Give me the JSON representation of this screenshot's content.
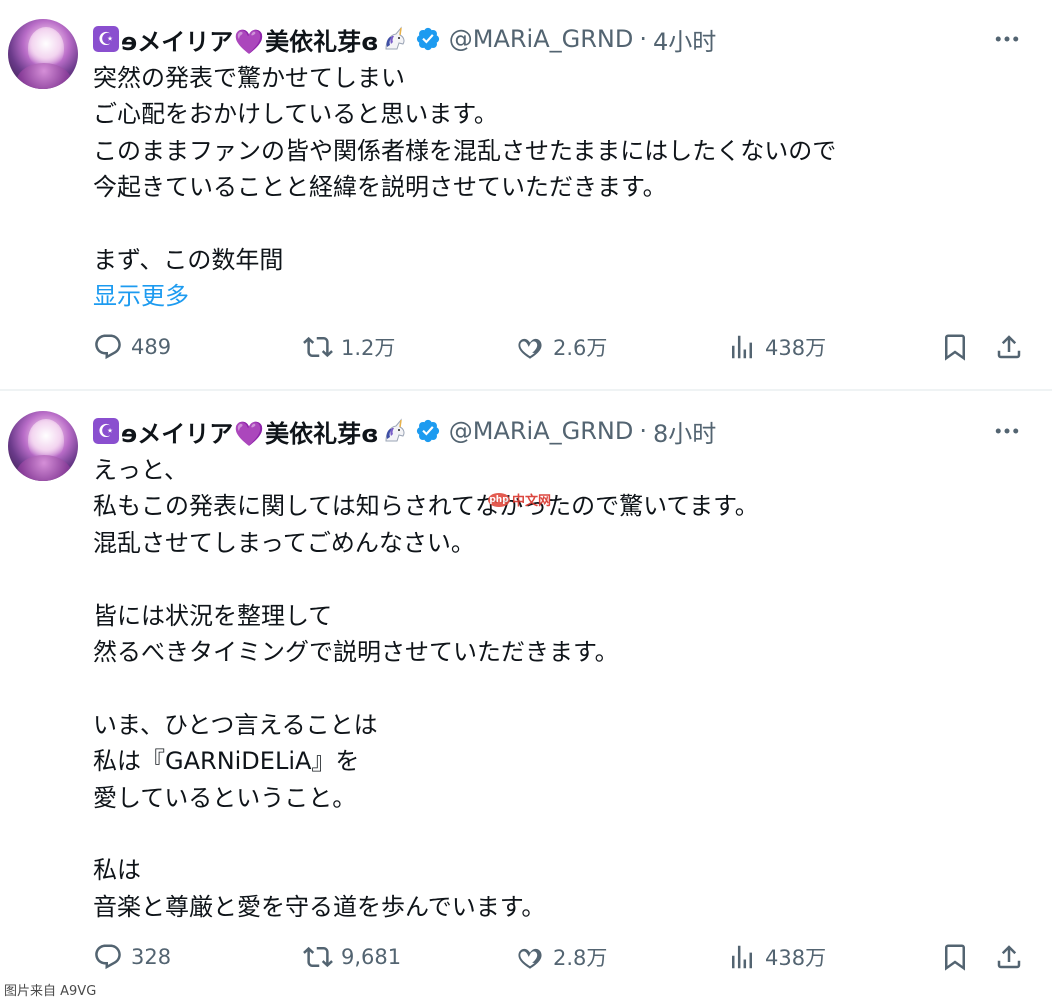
{
  "tweets": [
    {
      "author": {
        "moon_badge": "☪",
        "name_prefix": "ɘメイリア",
        "heart": "💜",
        "name_suffix": "美依礼芽ɞ",
        "handle": "@MARiA_GRND",
        "separator": "·",
        "time": "4小时"
      },
      "lines": [
        "突然の発表で驚かせてしまい",
        "ご心配をおかけしていると思います。",
        "このままファンの皆や関係者様を混乱させたままにはしたくないので",
        "今起きていることと経緯を説明させていただきます。",
        "",
        "まず、この数年間"
      ],
      "show_more": "显示更多",
      "stats": {
        "replies": "489",
        "reposts": "1.2万",
        "likes": "2.6万",
        "views": "438万"
      }
    },
    {
      "author": {
        "moon_badge": "☪",
        "name_prefix": "ɘメイリア",
        "heart": "💜",
        "name_suffix": "美依礼芽ɞ",
        "handle": "@MARiA_GRND",
        "separator": "·",
        "time": "8小时"
      },
      "lines": [
        "えっと、",
        "私もこの発表に関しては知らされてなかったので驚いてます。",
        "混乱させてしまってごめんなさい。",
        "",
        "皆には状況を整理して",
        "然るべきタイミングで説明させていただきます。",
        "",
        "いま、ひとつ言えることは",
        "私は『GARNiDELiA』を",
        "愛しているということ。",
        "",
        "私は",
        "音楽と尊厳と愛を守る道を歩んでいます。"
      ],
      "stats": {
        "replies": "328",
        "reposts": "9,681",
        "likes": "2.8万",
        "views": "438万"
      }
    }
  ],
  "watermark": {
    "logo": "php",
    "text": "中文网"
  },
  "footer_credit": "图片来自 A9VG",
  "colors": {
    "text": "#0f1419",
    "muted": "#536471",
    "link": "#1d9bf0",
    "verified": "#1d9bf0",
    "badge": "#8a4fcf"
  }
}
